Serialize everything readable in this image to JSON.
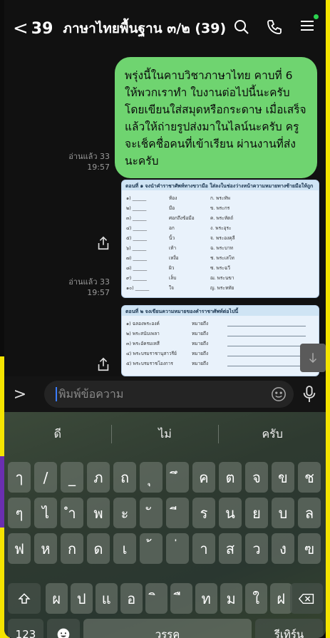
{
  "header": {
    "back_count": "39",
    "title": "ภาษาไทยพื้นฐาน ๓/๒ (39)"
  },
  "messages": {
    "text": "พรุ่งนี้ในคาบวิชาภาษาไทย คาบที่ 6 ให้พวกเราทำ ใบงานต่อไปนี้นะครับ โดยเขียนใส่สมุดหรือกระดาษ เมื่อเสร็จแล้วให้ถ่ายรูปส่งมาในไลน์นะครับ ครูจะเช็คชื่อคนที่เข้าเรียน ผ่านงานที่ส่งนะครับ",
    "read1": "อ่านแล้ว 33",
    "time1": "19:57",
    "read2": "อ่านแล้ว 33",
    "time2": "19:57"
  },
  "doc1": {
    "heading": "ตอนที่ ๑ จงนำคำราชาศัพท์ทางขวามือ ใส่ลงในช่องว่างหน้าความหมายทางซ้ายมือให้ถูก",
    "rows": [
      {
        "n": "๑) ______",
        "w": "ท้อง",
        "a": "ก. พระทัพ"
      },
      {
        "n": "๒) ______",
        "w": "มือ",
        "a": "ข. พระกร"
      },
      {
        "n": "๓) ______",
        "w": "ศอกถึงข้อมือ",
        "a": "ค. พระหัตถ์"
      },
      {
        "n": "๔) ______",
        "w": "อก",
        "a": "ง. พระอุระ"
      },
      {
        "n": "๕) ______",
        "w": "นิ้ว",
        "a": "จ. พระองคุลี"
      },
      {
        "n": "๖) ______",
        "w": "เท้า",
        "a": "ฉ. พระบาท"
      },
      {
        "n": "๗) ______",
        "w": "เหงื่อ",
        "a": "ช. พระเสโท"
      },
      {
        "n": "๘) ______",
        "w": "ผิว",
        "a": "ซ. พระฉวี"
      },
      {
        "n": "๙) ______",
        "w": "เล็บ",
        "a": "ฌ. พระนขา"
      },
      {
        "n": "๑๐) ______",
        "w": "ใจ",
        "a": "ญ. พระหทัย"
      }
    ]
  },
  "doc2": {
    "heading": "ตอนที่ ๒ จงเขียนความหมายของคำราชาศัพท์ต่อไปนี้",
    "rows": [
      {
        "n": "๑) ฉลองพระองค์",
        "m": "หมายถึง"
      },
      {
        "n": "๒) พระสนับเพลา",
        "m": "หมายถึง"
      },
      {
        "n": "๓) พระอัครมเหสี",
        "m": "หมายถึง"
      },
      {
        "n": "๔) พระบรมราชานุสาวรีย์",
        "m": "หมายถึง"
      },
      {
        "n": "๕) พระบรมราชโองการ",
        "m": "หมายถึง"
      }
    ]
  },
  "input": {
    "placeholder": "พิมพ์ข้อความ"
  },
  "keyboard": {
    "suggestions": [
      "ดี",
      "ไม่",
      "ครับ"
    ],
    "row1": [
      "ๅ",
      "/",
      "_",
      "ภ",
      "ถ",
      "ุ",
      "ึ",
      "ค",
      "ต",
      "จ",
      "ข",
      "ช"
    ],
    "row2": [
      "ๆ",
      "ไ",
      "ำ",
      "พ",
      "ะ",
      "ั",
      "ี",
      "ร",
      "น",
      "ย",
      "บ",
      "ล"
    ],
    "row3": [
      "ฟ",
      "ห",
      "ก",
      "ด",
      "เ",
      "้",
      "่",
      "า",
      "ส",
      "ว",
      "ง",
      "ฃ"
    ],
    "row4": [
      "ผ",
      "ป",
      "แ",
      "อ",
      "ิ",
      "ื",
      "ท",
      "ม",
      "ใ",
      "ฝ"
    ],
    "numbers_label": "123",
    "space_label": "วรรค",
    "return_label": "รีเทิร์น"
  }
}
